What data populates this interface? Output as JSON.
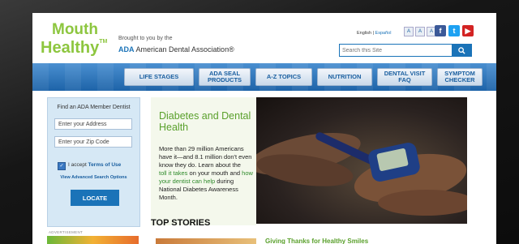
{
  "logo": {
    "line1": "Mouth",
    "line2": "Healthy",
    "tm": "TM"
  },
  "sponsor": {
    "brought": "Brought to you by the",
    "ada_short": "ADA",
    "ada_full": "American Dental Association®"
  },
  "language": {
    "english": "English",
    "separator": " | ",
    "espanol": "Español"
  },
  "font_size_buttons": [
    "A",
    "A",
    "A"
  ],
  "social": [
    {
      "name": "facebook",
      "glyph": "f"
    },
    {
      "name": "twitter",
      "glyph": "t"
    },
    {
      "name": "youtube",
      "glyph": "▶"
    }
  ],
  "search": {
    "placeholder": "Search this Site"
  },
  "nav": [
    "LIFE STAGES",
    "ADA SEAL PRODUCTS",
    "A-Z TOPICS",
    "NUTRITION",
    "DENTAL VISIT FAQ",
    "SYMPTOM CHECKER"
  ],
  "dentist_finder": {
    "title": "Find an ADA Member Dentist",
    "address_placeholder": "Enter your Address",
    "zip_placeholder": "Enter your Zip Code",
    "accept_prefix": "I accept ",
    "terms": "Terms of Use",
    "advanced": "View Advanced Search Options",
    "locate": "LOCATE"
  },
  "advertisement_label": "ADVERTISEMENT",
  "feature": {
    "heading": "Diabetes and Dental Health",
    "body_intro": "More than 29 million Americans have it—and 8.1 million don't even know they do. Learn about the",
    "link1": "toll it takes",
    "mid": " on your mouth and ",
    "link2": "how your dentist can help",
    "end": " during National Diabetes Awareness Month."
  },
  "top_stories": {
    "heading": "TOP STORIES",
    "first_story": "Giving Thanks for Healthy Smiles"
  },
  "colors": {
    "brand_green": "#8dc63f",
    "ada_blue": "#1a73b8",
    "nav_blue": "#1d63a8"
  }
}
